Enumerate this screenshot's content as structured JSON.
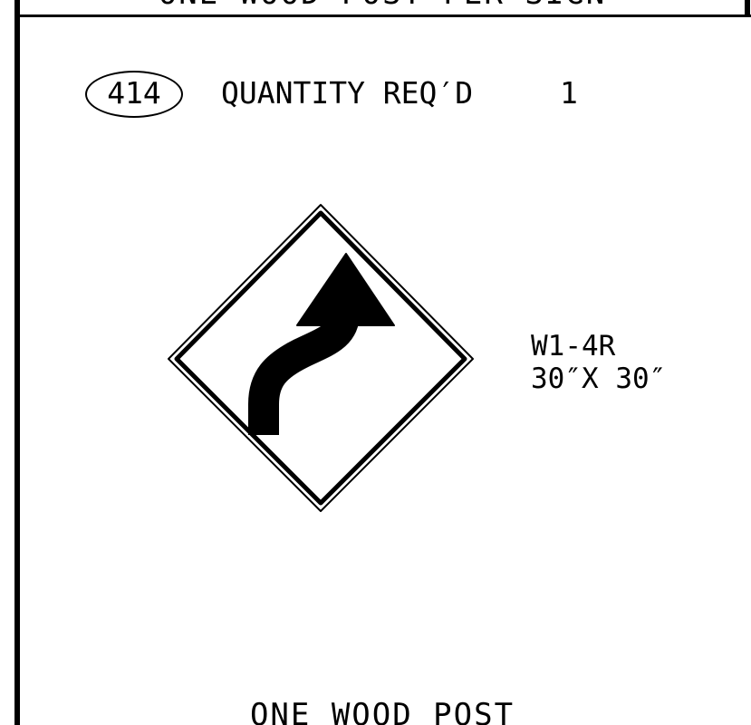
{
  "header": {
    "text": "ONE WOOD POST PER SIGN"
  },
  "sign_callout": {
    "number": "414",
    "quantity_label": "QUANTITY REQ′D",
    "quantity_value": "1"
  },
  "sign": {
    "code": "W1-4R",
    "size": "30″X 30″",
    "icon": "reverse-curve-right-arrow",
    "colors": {
      "background": "#ffffff",
      "symbol": "#000000",
      "border": "#000000"
    }
  },
  "footer": {
    "text": "ONE WOOD POST"
  }
}
